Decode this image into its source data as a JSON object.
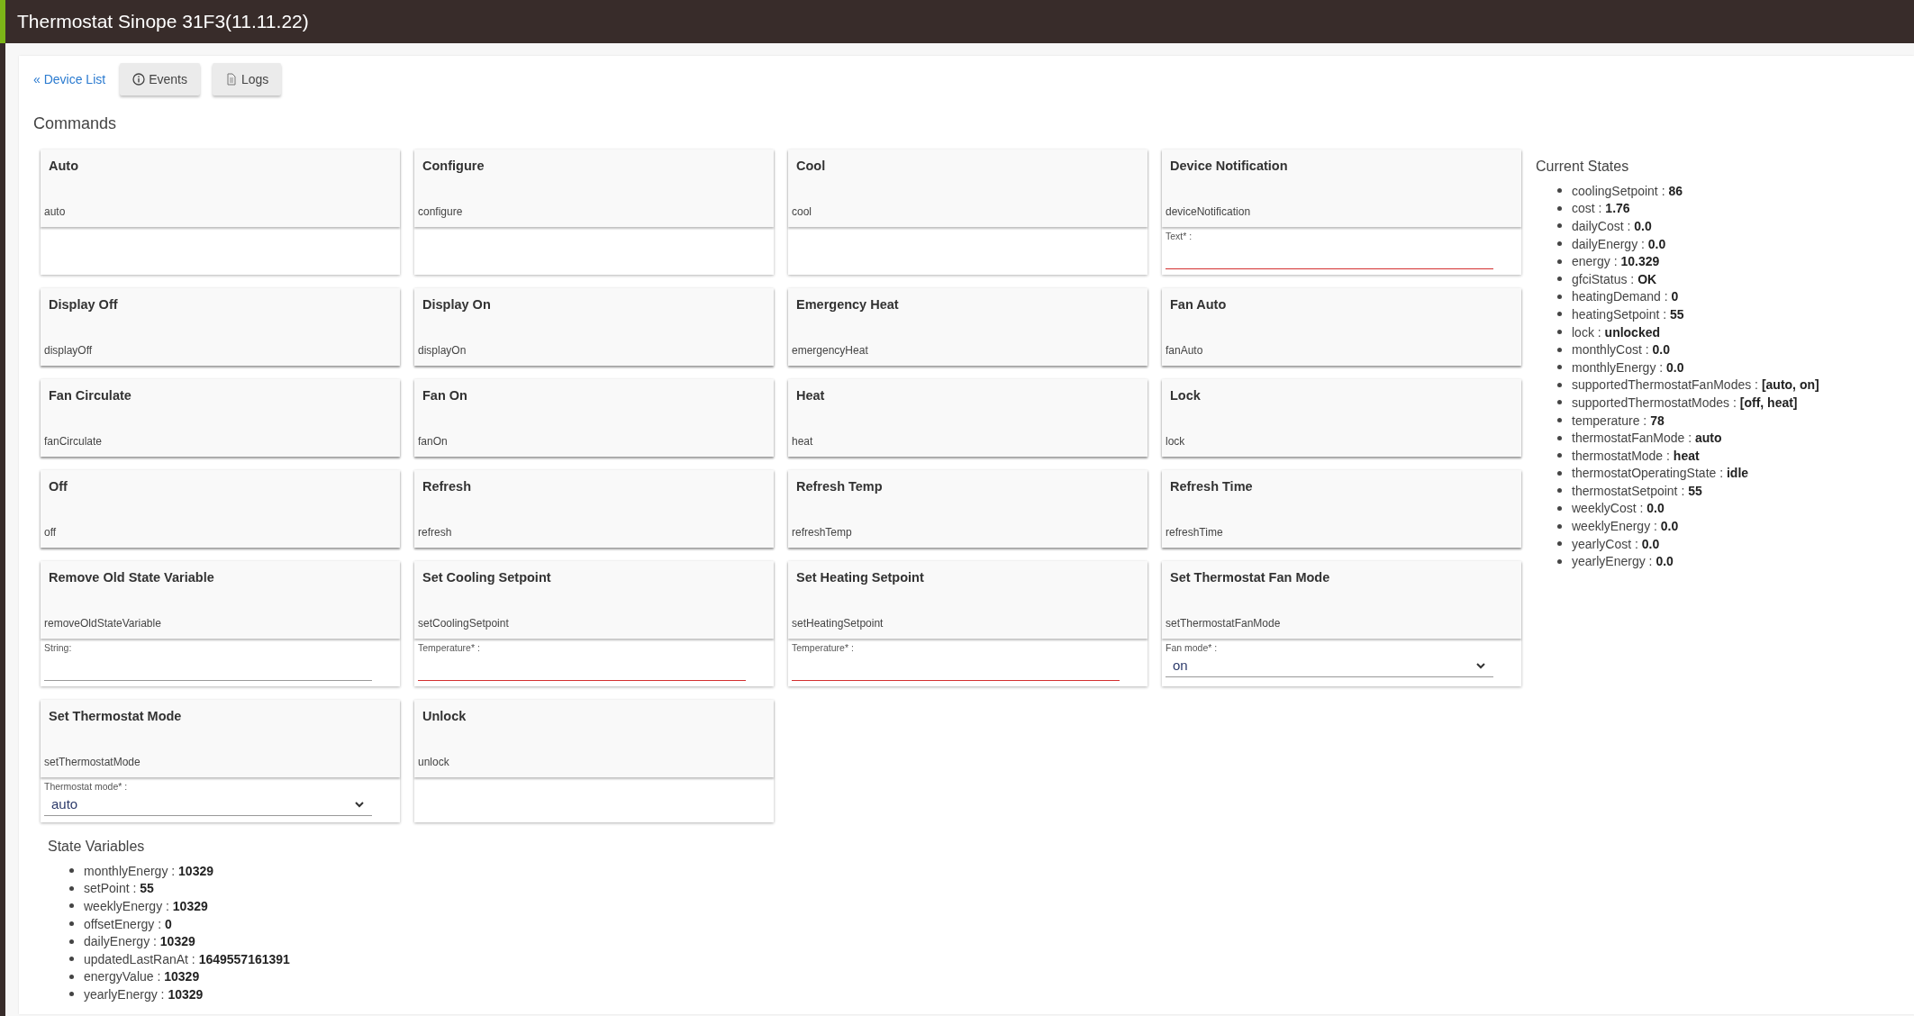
{
  "header": {
    "title": "Thermostat Sinope 31F3(11.11.22)"
  },
  "nav": {
    "back_link": "« Device List",
    "events_button": "Events",
    "logs_button": "Logs"
  },
  "commands": {
    "title": "Commands",
    "items": [
      {
        "name": "Auto",
        "method": "auto"
      },
      {
        "name": "Configure",
        "method": "configure"
      },
      {
        "name": "Cool",
        "method": "cool"
      },
      {
        "name": "Device Notification",
        "method": "deviceNotification",
        "params": [
          {
            "kind": "text",
            "label": "Text* :",
            "required": true
          }
        ]
      },
      {
        "name": "Display Off",
        "method": "displayOff"
      },
      {
        "name": "Display On",
        "method": "displayOn"
      },
      {
        "name": "Emergency Heat",
        "method": "emergencyHeat"
      },
      {
        "name": "Fan Auto",
        "method": "fanAuto"
      },
      {
        "name": "Fan Circulate",
        "method": "fanCirculate"
      },
      {
        "name": "Fan On",
        "method": "fanOn"
      },
      {
        "name": "Heat",
        "method": "heat"
      },
      {
        "name": "Lock",
        "method": "lock"
      },
      {
        "name": "Off",
        "method": "off"
      },
      {
        "name": "Refresh",
        "method": "refresh"
      },
      {
        "name": "Refresh Temp",
        "method": "refreshTemp"
      },
      {
        "name": "Refresh Time",
        "method": "refreshTime"
      },
      {
        "name": "Remove Old State Variable",
        "method": "removeOldStateVariable",
        "params": [
          {
            "kind": "text",
            "label": "String:",
            "required": false
          }
        ]
      },
      {
        "name": "Set Cooling Setpoint",
        "method": "setCoolingSetpoint",
        "params": [
          {
            "kind": "text",
            "label": "Temperature* :",
            "required": true
          }
        ]
      },
      {
        "name": "Set Heating Setpoint",
        "method": "setHeatingSetpoint",
        "params": [
          {
            "kind": "text",
            "label": "Temperature* :",
            "required": true
          }
        ]
      },
      {
        "name": "Set Thermostat Fan Mode",
        "method": "setThermostatFanMode",
        "params": [
          {
            "kind": "select",
            "label": "Fan mode* :",
            "value": "on"
          }
        ]
      },
      {
        "name": "Set Thermostat Mode",
        "method": "setThermostatMode",
        "params": [
          {
            "kind": "select",
            "label": "Thermostat mode* :",
            "value": "auto"
          }
        ]
      },
      {
        "name": "Unlock",
        "method": "unlock"
      }
    ]
  },
  "current_states": {
    "title": "Current States",
    "items": [
      {
        "text": "coolingSetpoint : **86**"
      },
      {
        "text": "cost : **1.76**"
      },
      {
        "text": "dailyCost : **0.0**"
      },
      {
        "text": "dailyEnergy : **0.0**"
      },
      {
        "text": "energy : **10.329**"
      },
      {
        "text": "gfciStatus : **OK**"
      },
      {
        "text": "heatingDemand : **0**"
      },
      {
        "text": "heatingSetpoint : **55**"
      },
      {
        "text": "lock : **unlocked**"
      },
      {
        "text": "monthlyCost : **0.0**"
      },
      {
        "text": "monthlyEnergy : **0.0**"
      },
      {
        "text": "supportedThermostatFanModes : **[auto, on]**"
      },
      {
        "text": "supportedThermostatModes : **[off, heat]**"
      },
      {
        "text": "temperature : **78**"
      },
      {
        "text": "thermostatFanMode : **auto**"
      },
      {
        "text": "thermostatMode : **heat**"
      },
      {
        "text": "thermostatOperatingState : **idle**"
      },
      {
        "text": "thermostatSetpoint : **55**"
      },
      {
        "text": "weeklyCost : **0.0**"
      },
      {
        "text": "weeklyEnergy : **0.0**"
      },
      {
        "text": "yearlyCost : **0.0**"
      },
      {
        "text": "yearlyEnergy : **0.0**"
      }
    ]
  },
  "state_variables": {
    "title": "State Variables",
    "items": [
      {
        "text": "monthlyEnergy : **10329**"
      },
      {
        "text": "setPoint : **55**"
      },
      {
        "text": "weeklyEnergy : **10329**"
      },
      {
        "text": "offsetEnergy : **0**"
      },
      {
        "text": "dailyEnergy : **10329**"
      },
      {
        "text": "updatedLastRanAt : **1649557161391**"
      },
      {
        "text": "energyValue : **10329**"
      },
      {
        "text": "yearlyEnergy : **10329**"
      }
    ]
  }
}
